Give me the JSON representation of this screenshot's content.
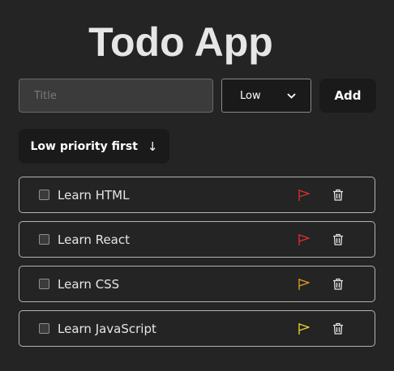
{
  "app": {
    "title": "Todo App"
  },
  "form": {
    "title_placeholder": "Title",
    "priority_selected": "Low",
    "add_label": "Add"
  },
  "sort": {
    "label": "Low priority first",
    "arrow": "↓"
  },
  "todos": [
    {
      "label": "Learn HTML",
      "flag_color": "#d9302c"
    },
    {
      "label": "Learn React",
      "flag_color": "#d9302c"
    },
    {
      "label": "Learn CSS",
      "flag_color": "#e39c25"
    },
    {
      "label": "Learn JavaScript",
      "flag_color": "#e8d630"
    }
  ],
  "icons": {
    "flag": "flag-icon",
    "trash": "trash-icon",
    "checkbox": "checkbox",
    "chevron": "chevron-down-icon"
  }
}
